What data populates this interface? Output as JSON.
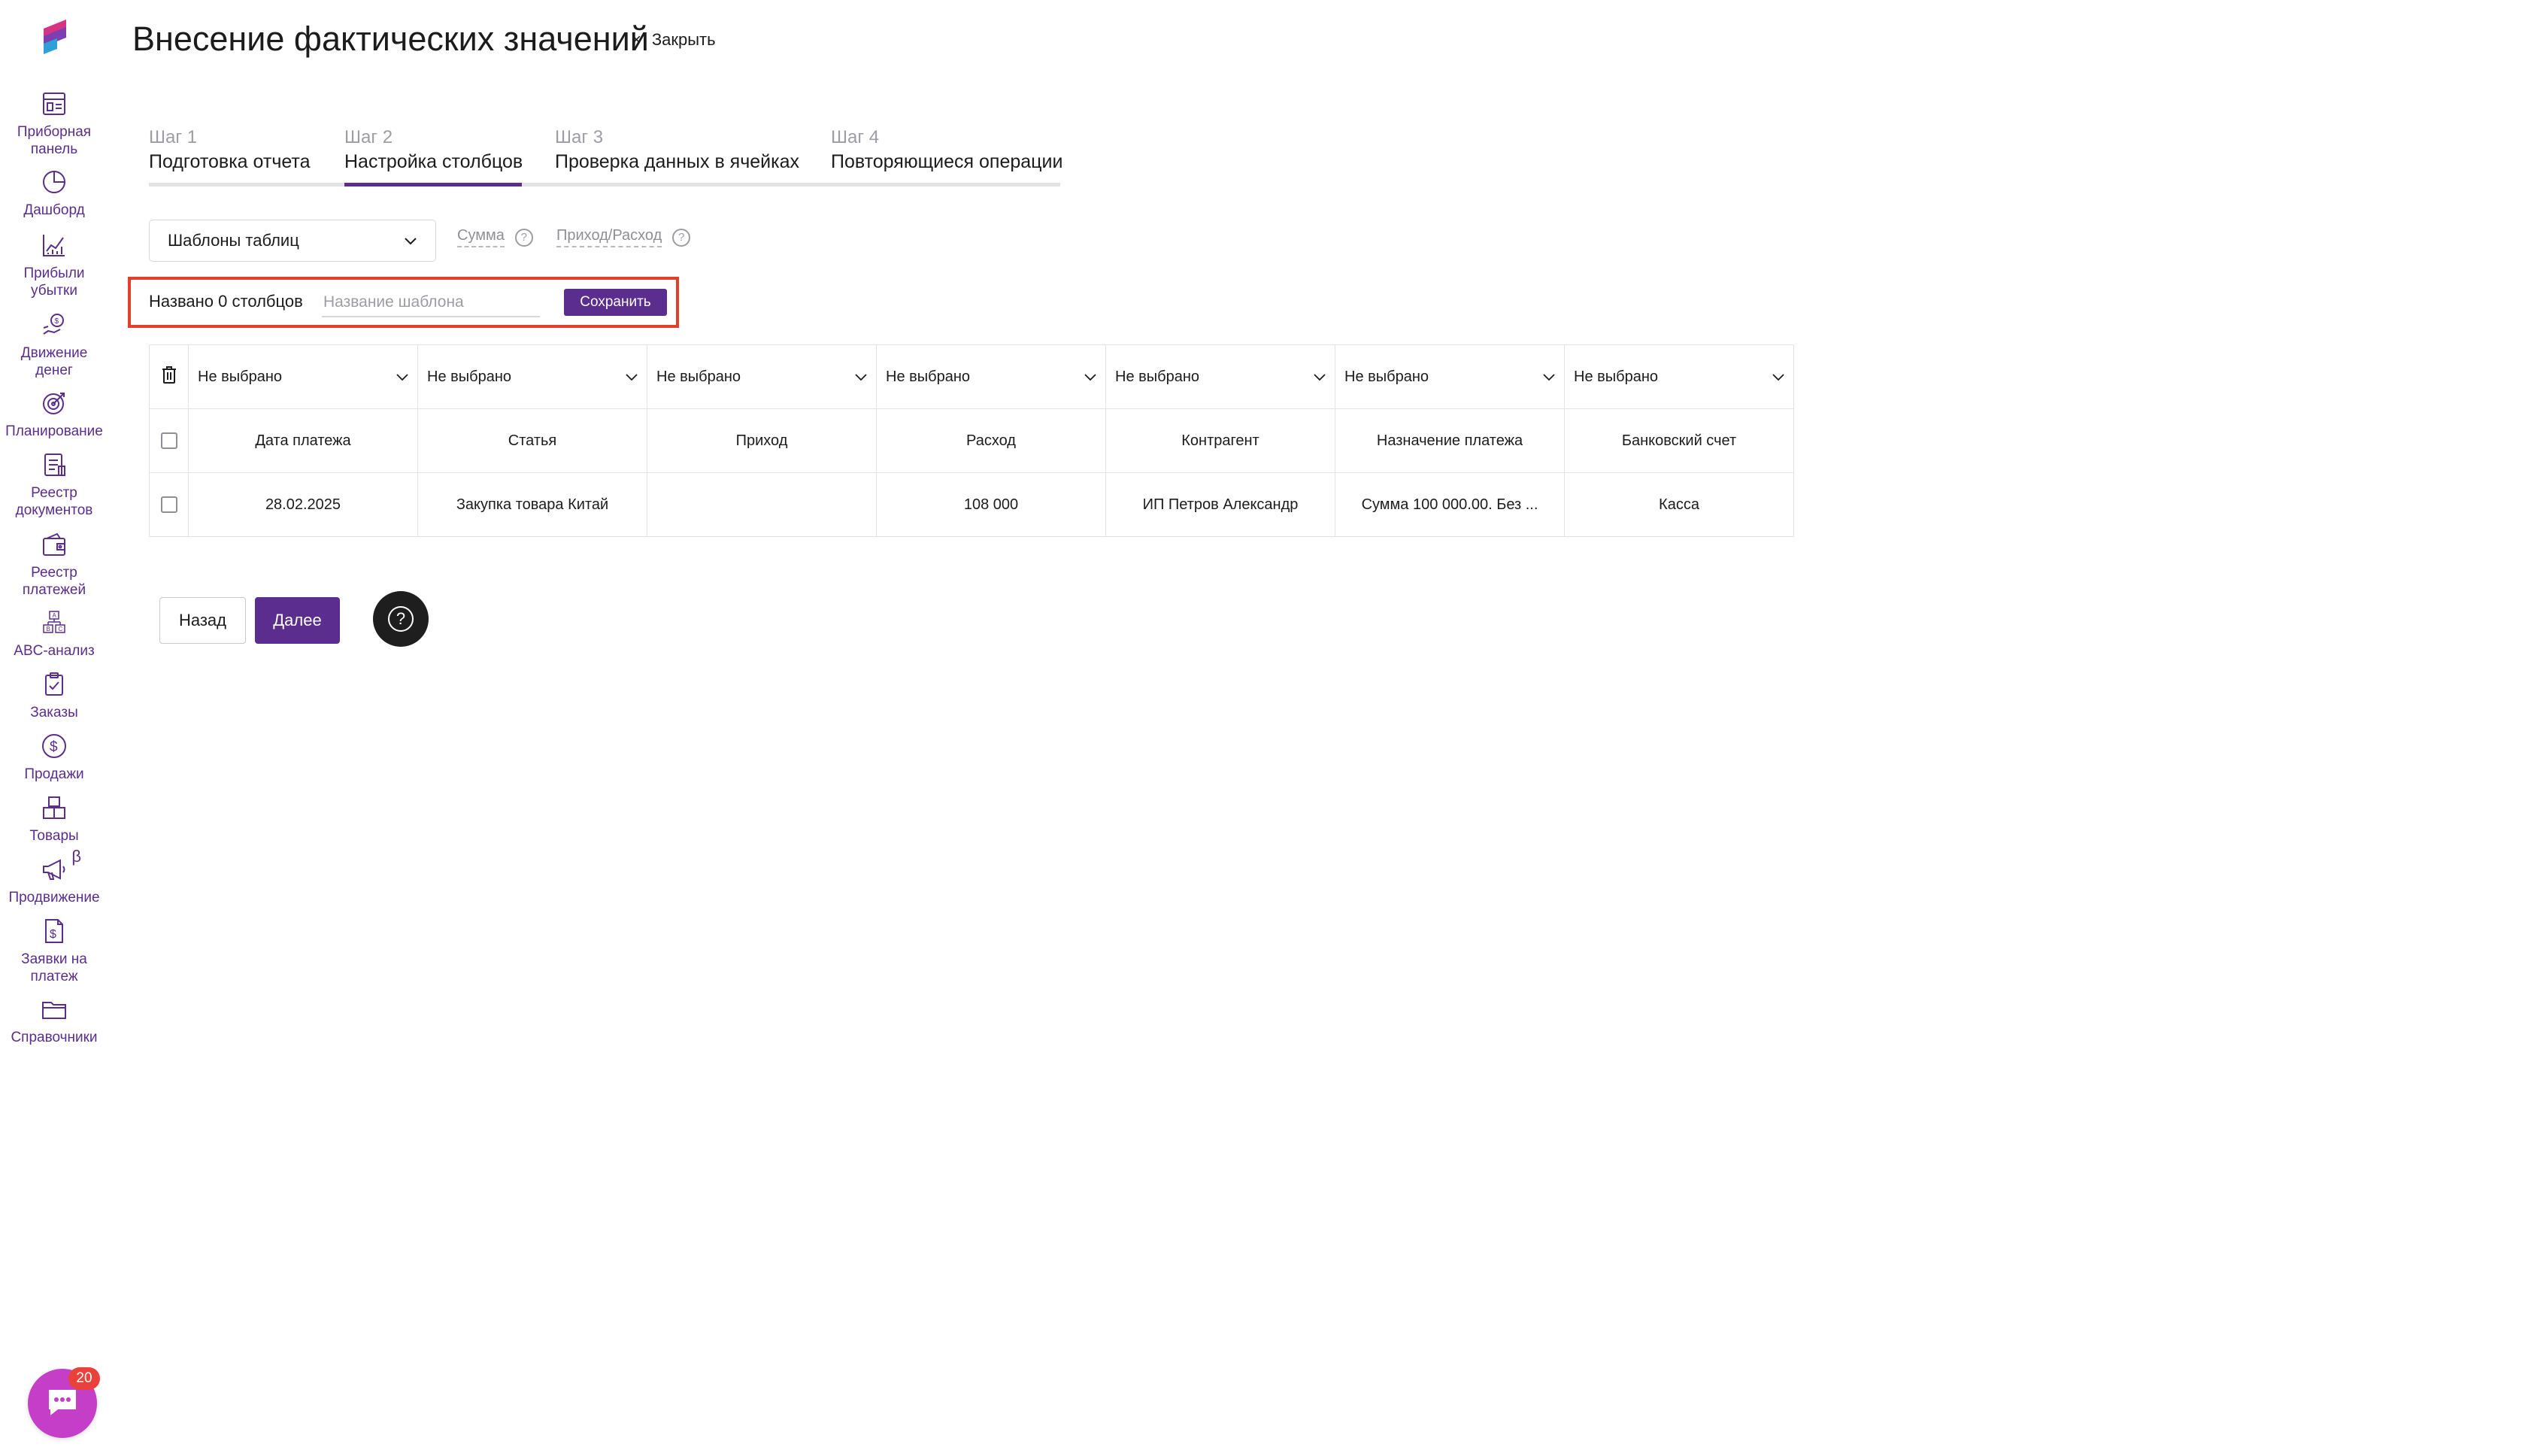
{
  "sidebar": {
    "items": [
      {
        "label": "Приборная\nпанель",
        "icon": "dashboard-panel-icon"
      },
      {
        "label": "Дашборд",
        "icon": "pie-chart-icon"
      },
      {
        "label": "Прибыли\nубытки",
        "icon": "line-chart-icon"
      },
      {
        "label": "Движение\nденег",
        "icon": "money-flow-icon"
      },
      {
        "label": "Планирование",
        "icon": "target-icon"
      },
      {
        "label": "Реестр\nдокументов",
        "icon": "documents-icon"
      },
      {
        "label": "Реестр\nплатежей",
        "icon": "wallet-icon"
      },
      {
        "label": "ABC-анализ",
        "icon": "abc-icon"
      },
      {
        "label": "Заказы",
        "icon": "clipboard-check-icon"
      },
      {
        "label": "Продажи",
        "icon": "dollar-circle-icon"
      },
      {
        "label": "Товары",
        "icon": "boxes-icon"
      },
      {
        "label": "Продвижение",
        "icon": "megaphone-icon",
        "badge": "β"
      },
      {
        "label": "Заявки на\nплатеж",
        "icon": "payment-request-icon"
      },
      {
        "label": "Справочники",
        "icon": "folder-icon"
      }
    ]
  },
  "chat": {
    "badge": "20",
    "icon": "chat-icon"
  },
  "header": {
    "title": "Внесение фактических значений",
    "close_label": "Закрыть",
    "close_icon": "×"
  },
  "steps": [
    {
      "num": "Шаг 1",
      "title": "Подготовка отчета"
    },
    {
      "num": "Шаг 2",
      "title": "Настройка столбцов",
      "active": true
    },
    {
      "num": "Шаг 3",
      "title": "Проверка данных в ячейках"
    },
    {
      "num": "Шаг 4",
      "title": "Повторяющиеся операции"
    }
  ],
  "controls": {
    "template_select": "Шаблоны таблиц",
    "legend_sum": "Сумма",
    "legend_income_expense": "Приход/Расход",
    "help_glyph": "?"
  },
  "template": {
    "count_label": "Названо 0 столбцов",
    "name_placeholder": "Название шаблона",
    "name_value": "",
    "save_label": "Сохранить"
  },
  "table": {
    "column_select_default": "Не выбрано",
    "column_selects": [
      "Не выбрано",
      "Не выбрано",
      "Не выбрано",
      "Не выбрано",
      "Не выбрано",
      "Не выбрано",
      "Не выбрано"
    ],
    "header_row": [
      "Дата платежа",
      "Статья",
      "Приход",
      "Расход",
      "Контрагент",
      "Назначение платежа",
      "Банковский счет"
    ],
    "data_rows": [
      [
        "28.02.2025",
        "Закупка товара Китай",
        "",
        "108 000",
        "ИП Петров Александр",
        "Сумма 100 000.00. Без ...",
        "Касса"
      ]
    ]
  },
  "footer": {
    "back_label": "Назад",
    "next_label": "Далее",
    "help_glyph": "?"
  },
  "colors": {
    "accent": "#5b2d8e",
    "highlight": "#e0402a",
    "chat": "#c53ec7",
    "badge": "#e8423a"
  }
}
